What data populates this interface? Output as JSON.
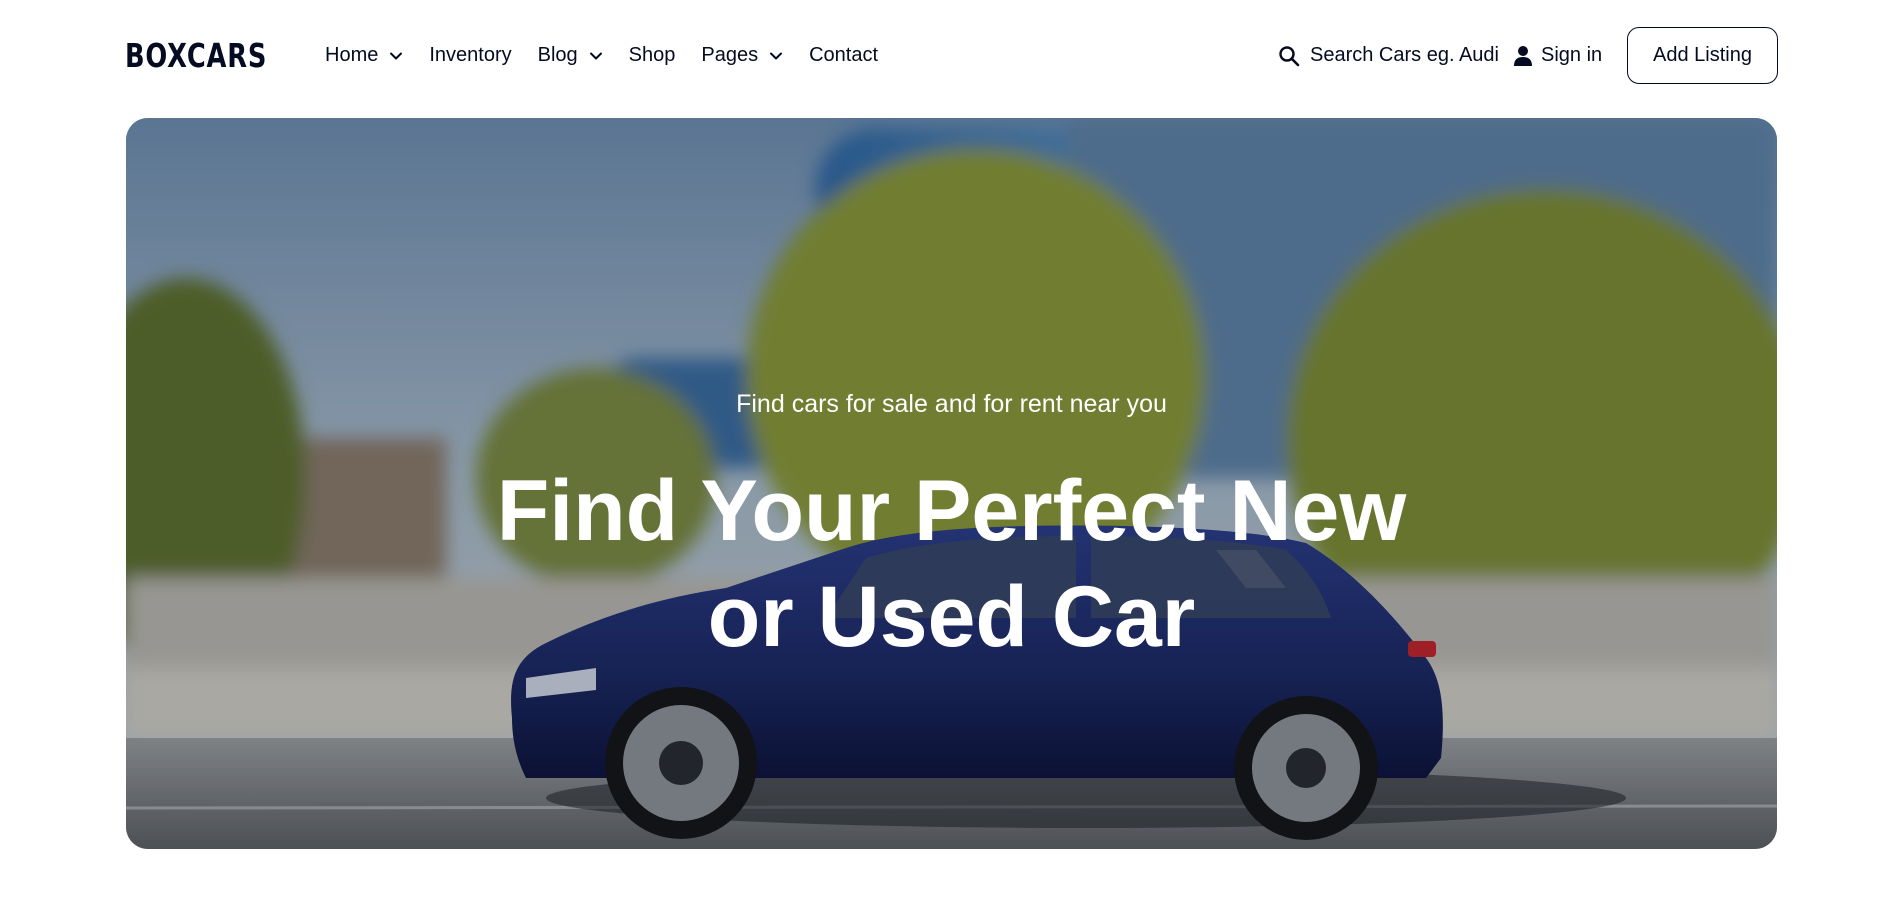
{
  "brand": {
    "logo_text": "BOXCARS"
  },
  "nav": {
    "items": [
      {
        "label": "Home",
        "has_dropdown": true
      },
      {
        "label": "Inventory",
        "has_dropdown": false
      },
      {
        "label": "Blog",
        "has_dropdown": true
      },
      {
        "label": "Shop",
        "has_dropdown": false
      },
      {
        "label": "Pages",
        "has_dropdown": true
      },
      {
        "label": "Contact",
        "has_dropdown": false
      }
    ]
  },
  "search": {
    "placeholder": "Search Cars eg. Audi",
    "icon": "search-icon"
  },
  "account": {
    "signin_label": "Sign in",
    "icon": "user-icon"
  },
  "actions": {
    "add_listing_label": "Add Listing"
  },
  "hero": {
    "subtitle": "Find cars for sale and for rent near you",
    "title_line1": "Find Your Perfect New",
    "title_line2": "or Used Car"
  },
  "colors": {
    "text": "#050b20",
    "background": "#ffffff",
    "hero_text": "#ffffff",
    "car": "#1f2d6b"
  }
}
